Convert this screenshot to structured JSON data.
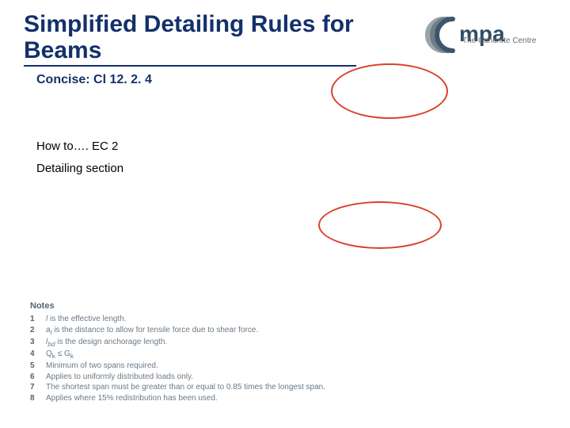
{
  "title": "Simplified Detailing Rules for Beams",
  "concise": "Concise: Cl 12. 2. 4",
  "howto": "How to…. EC 2",
  "detailing": "Detailing section",
  "logo": {
    "mpa": "mpa",
    "sub": "The Concrete Centre"
  },
  "notes": {
    "heading": "Notes",
    "items": [
      {
        "n": "1",
        "text_html": "<i>l</i> is the effective length."
      },
      {
        "n": "2",
        "text_html": "<i>a<sub>l</sub></i> is the distance to allow for tensile force due to shear force."
      },
      {
        "n": "3",
        "text_html": "<i>l<sub>bd</sub></i> is the design anchorage length."
      },
      {
        "n": "4",
        "text_html": "Q<sub>k</sub> ≤ G<sub>k</sub>"
      },
      {
        "n": "5",
        "text_html": "Minimum of two spans required."
      },
      {
        "n": "6",
        "text_html": "Applies to uniformly distributed loads only."
      },
      {
        "n": "7",
        "text_html": "The shortest span must be greater than or equal to 0.85 times the longest span."
      },
      {
        "n": "8",
        "text_html": "Applies where 15% redistribution has been used."
      }
    ]
  }
}
